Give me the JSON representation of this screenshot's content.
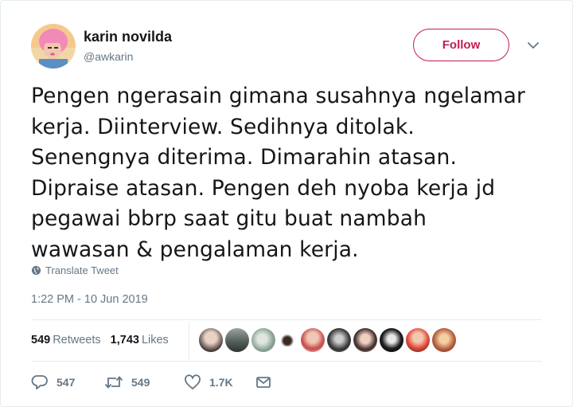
{
  "author": {
    "name": "karin novilda",
    "handle": "@awkarin"
  },
  "follow_label": "Follow",
  "tweet": {
    "lines": [
      "Pengen ngerasain gimana susahnya ngelamar",
      "kerja. Diinterview. Sedihnya ditolak.",
      "Senengnya diterima. Dimarahin atasan.",
      "Dipraise atasan. Pengen deh nyoba kerja jd",
      "pegawai bbrp saat gitu buat nambah",
      "wawasan & pengalaman kerja."
    ]
  },
  "translate_label": "Translate Tweet",
  "timestamp": "1:22 PM - 10 Jun 2019",
  "stats": {
    "retweets_count": "549",
    "retweets_label": "Retweets",
    "likes_count": "1,743",
    "likes_label": "Likes"
  },
  "likers_count": 10,
  "actions": {
    "replies": "547",
    "retweets": "549",
    "likes": "1.7K"
  },
  "colors": {
    "accent": "#c21d4f",
    "text": "#14171a",
    "muted": "#657786",
    "border": "#e6ecf0"
  },
  "icons": [
    "globe-icon",
    "chevron-down-icon",
    "reply-icon",
    "retweet-icon",
    "heart-icon",
    "mail-icon"
  ]
}
